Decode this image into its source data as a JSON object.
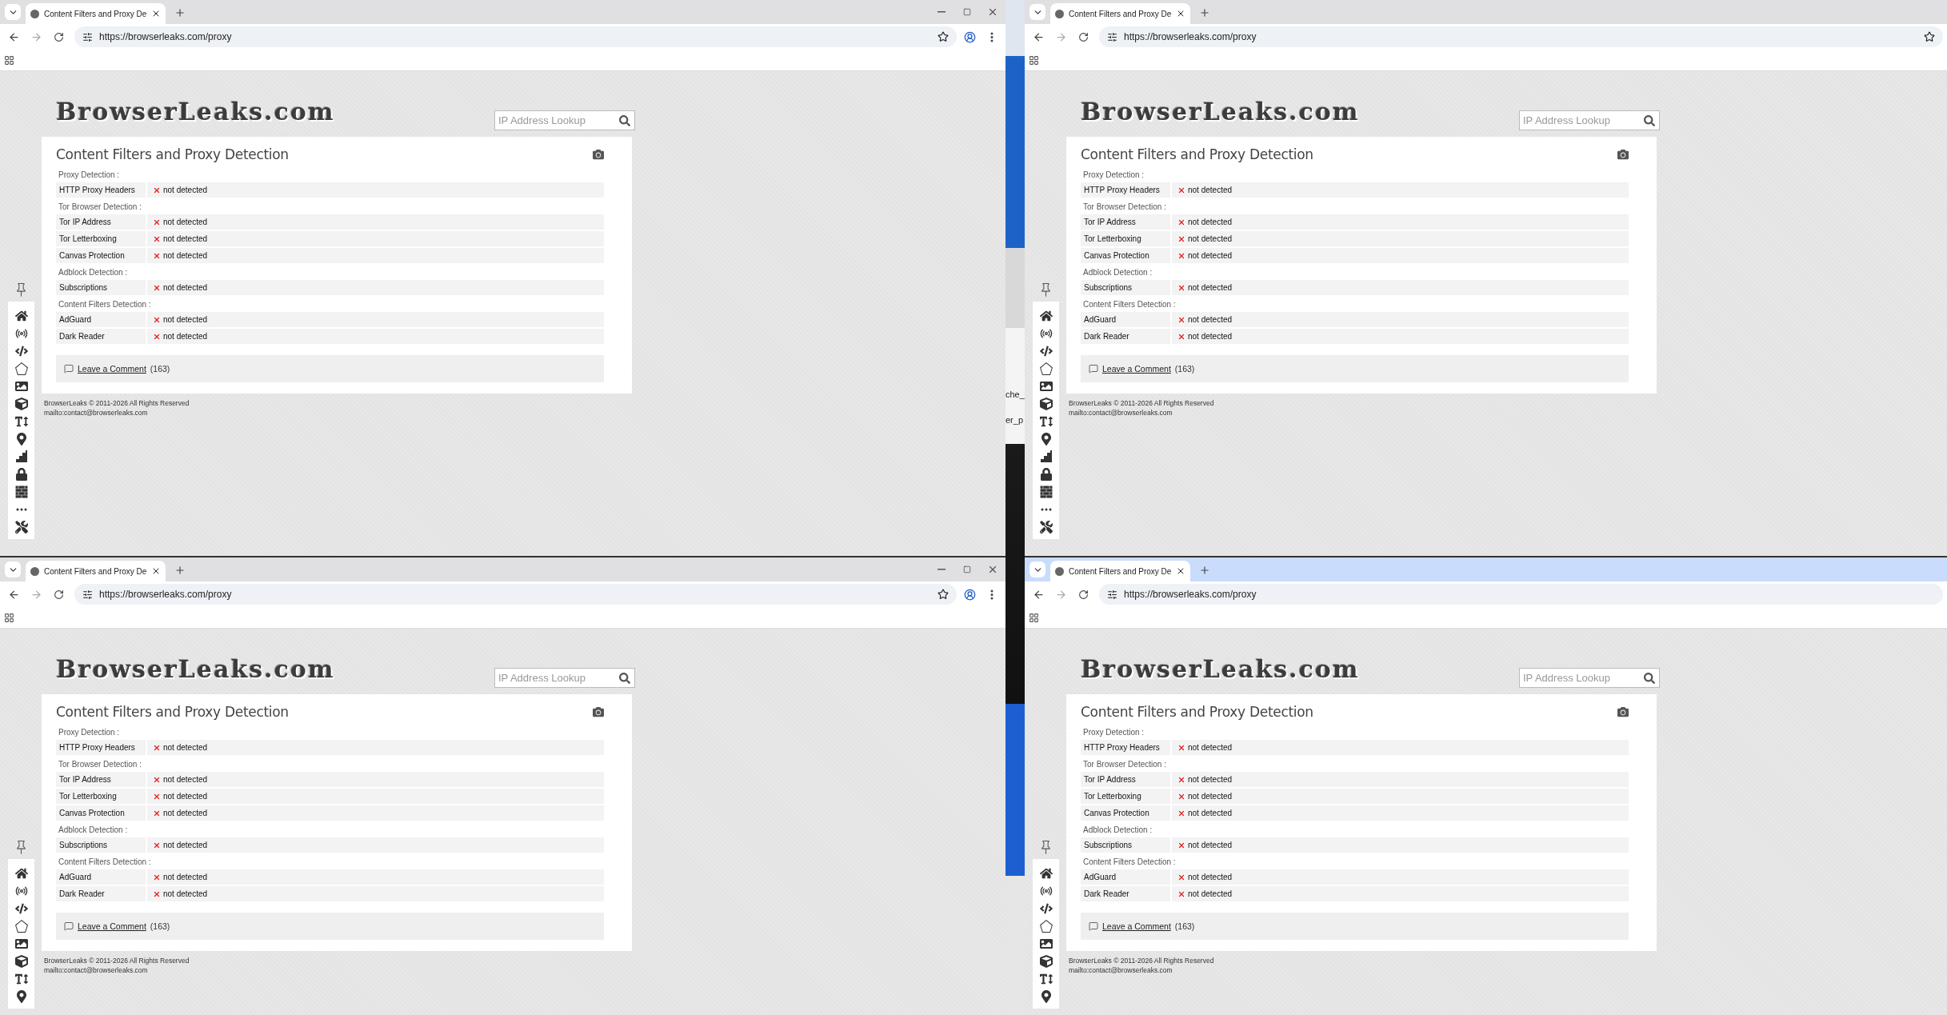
{
  "windows": [
    {
      "focused": false,
      "tab": {
        "title": "Content Filters and Proxy De"
      },
      "url": "https://browserleaks.com/proxy",
      "page": {
        "logo": "BrowserLeaks.com",
        "search": {
          "placeholder": "IP Address Lookup"
        },
        "title": "Content Filters and Proxy Detection",
        "sections": [
          {
            "heading": "Proxy Detection :",
            "rows": [
              {
                "label": "HTTP Proxy Headers",
                "value": "not detected"
              }
            ]
          },
          {
            "heading": "Tor Browser Detection :",
            "rows": [
              {
                "label": "Tor IP Address",
                "value": "not detected"
              },
              {
                "label": "Tor Letterboxing",
                "value": "not detected"
              },
              {
                "label": "Canvas Protection",
                "value": "not detected"
              }
            ]
          },
          {
            "heading": "Adblock Detection :",
            "rows": [
              {
                "label": "Subscriptions",
                "value": "not detected"
              }
            ]
          },
          {
            "heading": "Content Filters Detection :",
            "rows": [
              {
                "label": "AdGuard",
                "value": "not detected"
              },
              {
                "label": "Dark Reader",
                "value": "not detected"
              }
            ]
          }
        ],
        "comment": {
          "link": "Leave a Comment",
          "count": "(163)"
        },
        "footer": [
          "BrowserLeaks © 2011-2026 All Rights Reserved",
          "mailto:contact@browserleaks.com"
        ]
      }
    },
    {
      "focused": false,
      "tab": {
        "title": "Content Filters and Proxy De"
      },
      "url": "https://browserleaks.com/proxy",
      "page": {
        "logo": "BrowserLeaks.com",
        "search": {
          "placeholder": "IP Address Lookup"
        },
        "title": "Content Filters and Proxy Detection",
        "sections": [
          {
            "heading": "Proxy Detection :",
            "rows": [
              {
                "label": "HTTP Proxy Headers",
                "value": "not detected"
              }
            ]
          },
          {
            "heading": "Tor Browser Detection :",
            "rows": [
              {
                "label": "Tor IP Address",
                "value": "not detected"
              },
              {
                "label": "Tor Letterboxing",
                "value": "not detected"
              },
              {
                "label": "Canvas Protection",
                "value": "not detected"
              }
            ]
          },
          {
            "heading": "Adblock Detection :",
            "rows": [
              {
                "label": "Subscriptions",
                "value": "not detected"
              }
            ]
          },
          {
            "heading": "Content Filters Detection :",
            "rows": [
              {
                "label": "AdGuard",
                "value": "not detected"
              },
              {
                "label": "Dark Reader",
                "value": "not detected"
              }
            ]
          }
        ],
        "comment": {
          "link": "Leave a Comment",
          "count": "(163)"
        },
        "footer": [
          "BrowserLeaks © 2011-2026 All Rights Reserved",
          "mailto:contact@browserleaks.com"
        ]
      }
    },
    {
      "focused": false,
      "tab": {
        "title": "Content Filters and Proxy De"
      },
      "url": "https://browserleaks.com/proxy",
      "page": {
        "logo": "BrowserLeaks.com",
        "search": {
          "placeholder": "IP Address Lookup"
        },
        "title": "Content Filters and Proxy Detection",
        "sections": [
          {
            "heading": "Proxy Detection :",
            "rows": [
              {
                "label": "HTTP Proxy Headers",
                "value": "not detected"
              }
            ]
          },
          {
            "heading": "Tor Browser Detection :",
            "rows": [
              {
                "label": "Tor IP Address",
                "value": "not detected"
              },
              {
                "label": "Tor Letterboxing",
                "value": "not detected"
              },
              {
                "label": "Canvas Protection",
                "value": "not detected"
              }
            ]
          },
          {
            "heading": "Adblock Detection :",
            "rows": [
              {
                "label": "Subscriptions",
                "value": "not detected"
              }
            ]
          },
          {
            "heading": "Content Filters Detection :",
            "rows": [
              {
                "label": "AdGuard",
                "value": "not detected"
              },
              {
                "label": "Dark Reader",
                "value": "not detected"
              }
            ]
          }
        ],
        "comment": {
          "link": "Leave a Comment",
          "count": "(163)"
        },
        "footer": [
          "BrowserLeaks © 2011-2026 All Rights Reserved",
          "mailto:contact@browserleaks.com"
        ]
      }
    },
    {
      "focused": true,
      "tab": {
        "title": "Content Filters and Proxy De"
      },
      "url": "https://browserleaks.com/proxy",
      "page": {
        "logo": "BrowserLeaks.com",
        "search": {
          "placeholder": "IP Address Lookup"
        },
        "title": "Content Filters and Proxy Detection",
        "sections": [
          {
            "heading": "Proxy Detection :",
            "rows": [
              {
                "label": "HTTP Proxy Headers",
                "value": "not detected"
              }
            ]
          },
          {
            "heading": "Tor Browser Detection :",
            "rows": [
              {
                "label": "Tor IP Address",
                "value": "not detected"
              },
              {
                "label": "Tor Letterboxing",
                "value": "not detected"
              },
              {
                "label": "Canvas Protection",
                "value": "not detected"
              }
            ]
          },
          {
            "heading": "Adblock Detection :",
            "rows": [
              {
                "label": "Subscriptions",
                "value": "not detected"
              }
            ]
          },
          {
            "heading": "Content Filters Detection :",
            "rows": [
              {
                "label": "AdGuard",
                "value": "not detected"
              },
              {
                "label": "Dark Reader",
                "value": "not detected"
              }
            ]
          }
        ],
        "comment": {
          "link": "Leave a Comment",
          "count": "(163)"
        },
        "footer": [
          "BrowserLeaks © 2011-2026 All Rights Reserved",
          "mailto:contact@browserleaks.com"
        ]
      }
    }
  ],
  "desktop": {
    "fragments": [
      "che_",
      "er_p"
    ]
  }
}
